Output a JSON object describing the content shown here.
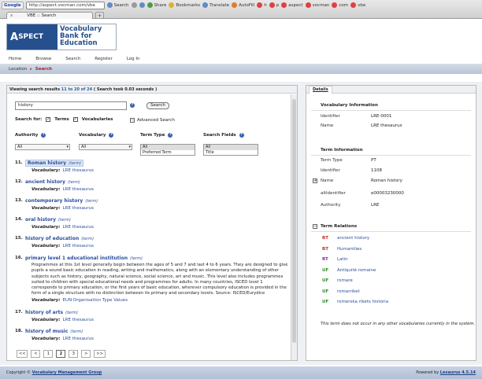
{
  "browser": {
    "google_label": "Google",
    "url": "http://aspect.vocman.com/vbe",
    "toolbar": [
      {
        "label": "Search",
        "icon": "magnifier-icon"
      },
      {
        "label": "Share",
        "icon": "share-icon"
      },
      {
        "label": "Bookmarks",
        "icon": "star-icon"
      },
      {
        "label": "Translate",
        "icon": "translate-icon"
      },
      {
        "label": "AutoFill",
        "icon": "pencil-icon"
      },
      {
        "label": "h",
        "icon": "bookmark-icon"
      },
      {
        "label": "p",
        "icon": "bookmark-icon"
      },
      {
        "label": "aspect",
        "icon": "bookmark-icon"
      },
      {
        "label": "vocman",
        "icon": "bookmark-icon"
      },
      {
        "label": "com",
        "icon": "bookmark-icon"
      },
      {
        "label": "vbe",
        "icon": "bookmark-icon"
      }
    ],
    "tab_title": "VBE :: Search",
    "tab_close": "x",
    "new_tab": "+"
  },
  "brand": {
    "mark": "SPECT",
    "mark_initial": "A",
    "name": "Vocabulary Bank for Education",
    "colors": {
      "brand": "#264f8d",
      "accent": "#b02020"
    }
  },
  "nav": [
    "Home",
    "Browse",
    "Search",
    "Register",
    "Log In"
  ],
  "breadcrumb": {
    "root": "Location",
    "sep": "▸",
    "current": "Search"
  },
  "left": {
    "status_prefix": "Viewing search results",
    "status_range": "11 to 20 of 24",
    "status_time": "( Search took 0.03 seconds )",
    "search_value": "history",
    "search_button": "Search",
    "search_for_label": "Search for:",
    "opt_terms": "Terms",
    "opt_vocabularies": "Vocabularies",
    "advanced": "Advanced Search",
    "filters": {
      "authority": "Authority",
      "vocabulary": "Vocabulary",
      "term_type": "Term Type",
      "search_fields": "Search Fields"
    },
    "authority_value": "All",
    "vocabulary_value": "All",
    "term_type_options": [
      "All",
      "Preferred Term"
    ],
    "search_fields_options": [
      "All",
      "Title"
    ],
    "vocab_label": "Vocabulary:",
    "results": [
      {
        "n": "11.",
        "title": "Roman history",
        "kind": "(term)",
        "vocab": "LRE thesaurus"
      },
      {
        "n": "12.",
        "title": "ancient history",
        "kind": "(term)",
        "vocab": "LRE thesaurus"
      },
      {
        "n": "13.",
        "title": "contemporary history",
        "kind": "(term)",
        "vocab": "LRE thesaurus"
      },
      {
        "n": "14.",
        "title": "oral history",
        "kind": "(term)",
        "vocab": "LRE thesaurus"
      },
      {
        "n": "15.",
        "title": "history of education",
        "kind": "(term)",
        "vocab": "LRE thesaurus"
      },
      {
        "n": "16.",
        "title": "primary level 1 educational institution",
        "kind": "(term)",
        "vocab": "EUN Organisation Type Values",
        "desc": "Programmes at this 1st level generally begin between the ages of 5 and 7 and last 4 to 6 years. They are designed to give pupils a sound basic education in reading, writing and mathematics, along with an elementary understanding of other subjects such as history, geography, natural science, social science, art and music. This level also includes programmes suited to children with special educational needs and programmes for adults. In many countries, ISCED level 1 corresponds to primary education, or the first years of basic education, wherever compulsory education is provided in the form of a single structure with no distinction between its primary and secondary levels. Source: ISCED/Eurydice"
      },
      {
        "n": "17.",
        "title": "history of arts",
        "kind": "(term)",
        "vocab": "LRE thesaurus"
      },
      {
        "n": "18.",
        "title": "history of music",
        "kind": "(term)",
        "vocab": "LRE thesaurus"
      }
    ],
    "pager": [
      "<<",
      "<",
      "1",
      "2",
      "3",
      ">",
      ">>"
    ],
    "current_page": "2"
  },
  "details": {
    "tab": "Details",
    "vocab_info": "Vocabulary Information",
    "vocab_identifier_k": "Identifier",
    "vocab_identifier_v": "LRE-0001",
    "vocab_name_k": "Name",
    "vocab_name_v": "LRE thesaurus",
    "term_info": "Term Information",
    "term_type_k": "Term Type",
    "term_type_v": "PT",
    "term_id_k": "Identifier",
    "term_id_v": "1108",
    "term_name_k": "Name",
    "term_name_v": "Roman history",
    "altid_k": "altIdentifier",
    "altid_v": "e00003230000",
    "authority_k": "Authority",
    "authority_v": "LRE",
    "relations_title": "Term Relations",
    "relations": [
      {
        "type": "BT",
        "label": "ancient history"
      },
      {
        "type": "BT",
        "label": "Humanities"
      },
      {
        "type": "RT",
        "label": "Latin"
      },
      {
        "type": "UF",
        "label": "Antiquité romaine"
      },
      {
        "type": "UF",
        "label": "romare"
      },
      {
        "type": "UF",
        "label": "romarriket"
      },
      {
        "type": "UF",
        "label": "romerska rikets historia"
      }
    ],
    "note": "This term does not occur in any other vocabularies currently in the system."
  },
  "footer": {
    "copyright": "Copyright ©",
    "copyright_link": "Vocabulary Management Group",
    "powered": "Powered by",
    "powered_link": "Lexaurus 4.5.14"
  }
}
